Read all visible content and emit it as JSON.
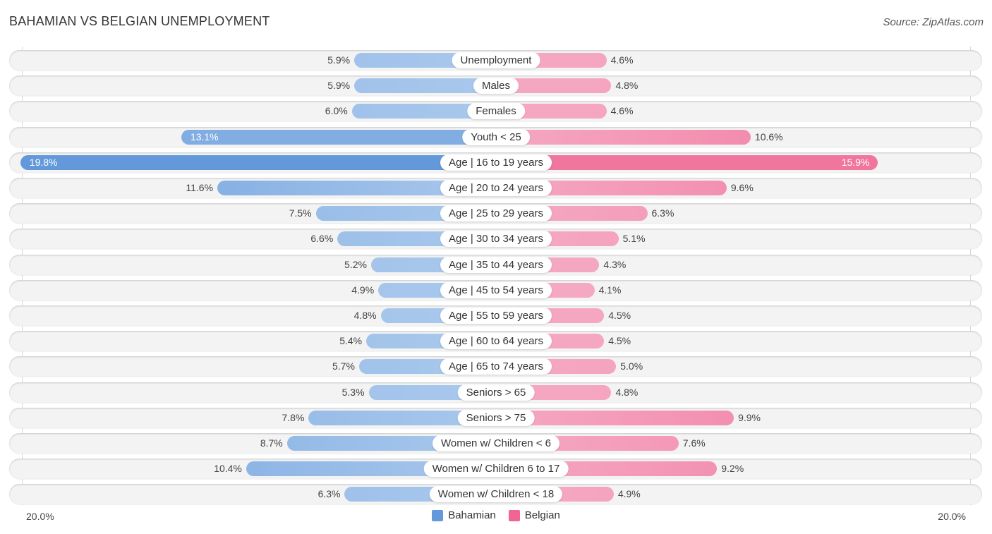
{
  "header": {
    "title": "BAHAMIAN VS BELGIAN UNEMPLOYMENT",
    "source": "Source: ZipAtlas.com"
  },
  "colors": {
    "bahamian_light": "#a9c8ec",
    "bahamian_strong": "#6399db",
    "belgian_light": "#f5a8c2",
    "belgian_strong": "#f06592"
  },
  "chart_data": {
    "type": "bar",
    "orientation": "horizontal-diverging",
    "title": "BAHAMIAN VS BELGIAN UNEMPLOYMENT",
    "xlabel": "",
    "ylabel": "",
    "xlim": [
      -20.0,
      20.0
    ],
    "axis_labels": {
      "left": "20.0%",
      "right": "20.0%"
    },
    "unit": "%",
    "legend_position": "bottom-center",
    "categories": [
      "Unemployment",
      "Males",
      "Females",
      "Youth < 25",
      "Age | 16 to 19 years",
      "Age | 20 to 24 years",
      "Age | 25 to 29 years",
      "Age | 30 to 34 years",
      "Age | 35 to 44 years",
      "Age | 45 to 54 years",
      "Age | 55 to 59 years",
      "Age | 60 to 64 years",
      "Age | 65 to 74 years",
      "Seniors > 65",
      "Seniors > 75",
      "Women w/ Children < 6",
      "Women w/ Children 6 to 17",
      "Women w/ Children < 18"
    ],
    "series": [
      {
        "name": "Bahamian",
        "side": "left",
        "values": [
          5.9,
          5.9,
          6.0,
          13.1,
          19.8,
          11.6,
          7.5,
          6.6,
          5.2,
          4.9,
          4.8,
          5.4,
          5.7,
          5.3,
          7.8,
          8.7,
          10.4,
          6.3
        ],
        "labels": [
          "5.9%",
          "5.9%",
          "6.0%",
          "13.1%",
          "19.8%",
          "11.6%",
          "7.5%",
          "6.6%",
          "5.2%",
          "4.9%",
          "4.8%",
          "5.4%",
          "5.7%",
          "5.3%",
          "7.8%",
          "8.7%",
          "10.4%",
          "6.3%"
        ]
      },
      {
        "name": "Belgian",
        "side": "right",
        "values": [
          4.6,
          4.8,
          4.6,
          10.6,
          15.9,
          9.6,
          6.3,
          5.1,
          4.3,
          4.1,
          4.5,
          4.5,
          5.0,
          4.8,
          9.9,
          7.6,
          9.2,
          4.9
        ],
        "labels": [
          "4.6%",
          "4.8%",
          "4.6%",
          "10.6%",
          "15.9%",
          "9.6%",
          "6.3%",
          "5.1%",
          "4.3%",
          "4.1%",
          "4.5%",
          "4.5%",
          "5.0%",
          "4.8%",
          "9.9%",
          "7.6%",
          "9.2%",
          "4.9%"
        ]
      }
    ]
  },
  "legend": {
    "items": [
      {
        "label": "Bahamian"
      },
      {
        "label": "Belgian"
      }
    ]
  }
}
